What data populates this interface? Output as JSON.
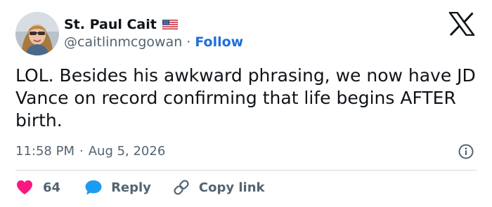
{
  "author": {
    "display_name": "St. Paul Cait",
    "handle": "@caitlinmcgowan",
    "separator": "·",
    "follow_label": "Follow",
    "flag_icon": "us-flag-icon",
    "avatar_icon": "avatar"
  },
  "platform": {
    "logo_icon": "x-logo-icon"
  },
  "tweet": {
    "text": "LOL. Besides his awkward phrasing, we now have JD Vance on record confirming that life begins AFTER birth.",
    "time": "11:58 PM",
    "date_separator": "·",
    "date": "Aug 5, 2026",
    "info_icon": "info-icon"
  },
  "actions": {
    "like_count": "64",
    "like_icon": "heart-icon",
    "reply_label": "Reply",
    "reply_icon": "speech-bubble-icon",
    "copy_label": "Copy link",
    "copy_icon": "link-icon"
  },
  "colors": {
    "text_primary": "#0f1419",
    "text_secondary": "#536471",
    "link_blue": "#1d6fdb",
    "heart_pink": "#f91880",
    "reply_blue": "#1d9bf0",
    "divider": "#cfd9de"
  }
}
